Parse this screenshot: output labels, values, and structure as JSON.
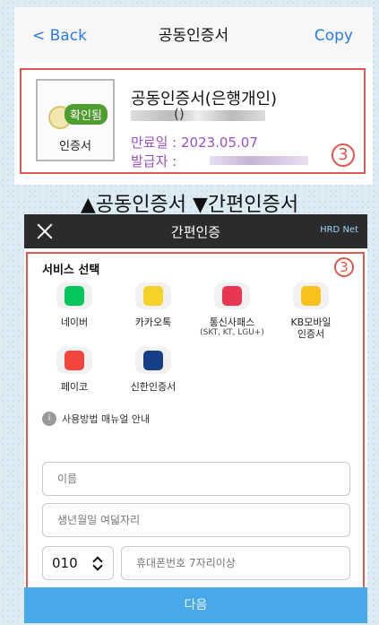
{
  "top_screen": {
    "nav": {
      "back_label": "< Back",
      "title": "공동인증서",
      "copy_label": "Copy"
    },
    "certificate": {
      "badge_label": "확인됨",
      "icon_label": "인증서",
      "name": "공동인증서(은행개인)",
      "owner_paren": "()",
      "expiry": "만료일 : 2023.05.07",
      "issuer_label": "발급자 :"
    },
    "marker": "3"
  },
  "caption": "▲공동인증서 ▼간편인증서",
  "bottom_screen": {
    "header": {
      "title": "간편인증",
      "logo_text": "HRD Net"
    },
    "service_section": {
      "title": "서비스 선택",
      "marker": "3",
      "services": [
        {
          "name": "네이버",
          "sub": "",
          "color": "#03c75a",
          "glyph": "N"
        },
        {
          "name": "카카오톡",
          "sub": "",
          "color": "#f5d226",
          "glyph": "TALK"
        },
        {
          "name": "통신사패스",
          "sub": "(SKT, KT, LGU+)",
          "color": "#e8374f",
          "glyph": "PASS"
        },
        {
          "name": "KB모바일",
          "sub": "인증서",
          "color": "#f8c21b",
          "glyph": "KB"
        },
        {
          "name": "페이코",
          "sub": "",
          "color": "#f2463d",
          "glyph": "PAYCO"
        },
        {
          "name": "신한인증서",
          "sub": "",
          "color": "#173f86",
          "glyph": "신한"
        }
      ],
      "manual_label": "사용방법 매뉴얼 안내"
    },
    "form": {
      "name_placeholder": "이름",
      "birth_placeholder": "생년월일 여덟자리",
      "phone_prefix": "010",
      "phone_placeholder": "휴대폰번호 7자리이상"
    },
    "next_label": "다음"
  }
}
